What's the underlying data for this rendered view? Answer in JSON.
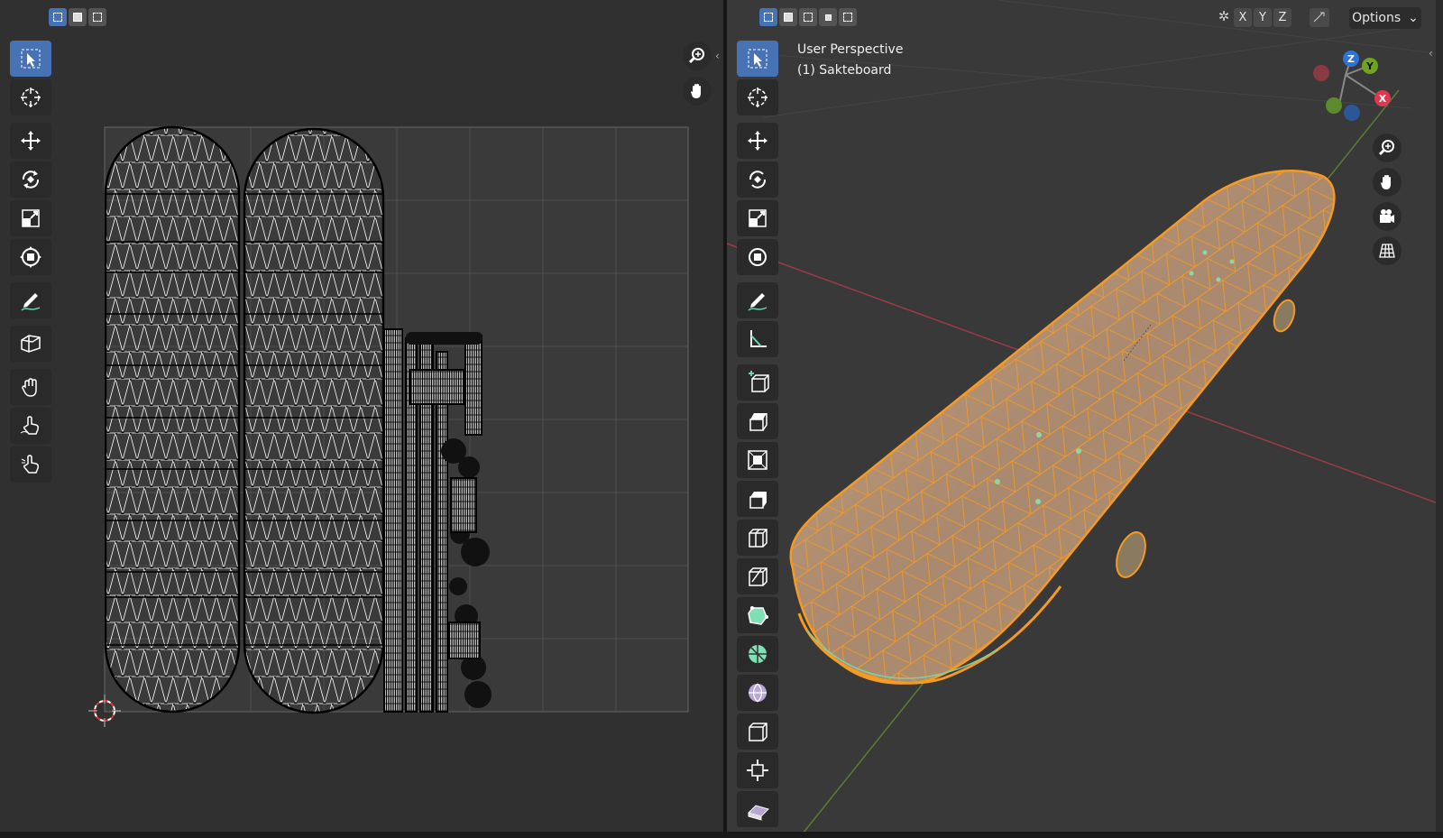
{
  "viewport": {
    "perspective_label": "User Perspective",
    "object_label": "(1) Sakteboard",
    "axes": [
      "X",
      "Y",
      "Z"
    ],
    "options_label": "Options"
  },
  "gizmo": {
    "z": "Z",
    "y": "Y",
    "x": "X"
  },
  "colors": {
    "accent": "#4772b3",
    "selection_orange": "#f59a23",
    "x_axis": "#e0394f",
    "y_axis": "#6fa321",
    "z_axis": "#2e74d6"
  },
  "uv_tools": [
    "select-box-icon",
    "cursor-icon",
    "move-icon",
    "rotate-icon",
    "scale-icon",
    "transform-icon",
    "annotate-icon",
    "rip-icon",
    "grab-icon",
    "relax-icon",
    "pinch-icon"
  ],
  "viewport_tools": [
    "select-box-icon",
    "cursor-icon",
    "move-icon",
    "rotate-icon",
    "scale-icon",
    "transform-icon",
    "annotate-icon",
    "measure-icon",
    "add-cube-icon",
    "extrude-icon",
    "inset-icon",
    "bevel-icon",
    "loop-cut-icon",
    "knife-icon",
    "poly-build-icon",
    "spin-icon",
    "smooth-icon",
    "edge-slide-icon",
    "shrink-fatten-icon",
    "shear-icon"
  ]
}
